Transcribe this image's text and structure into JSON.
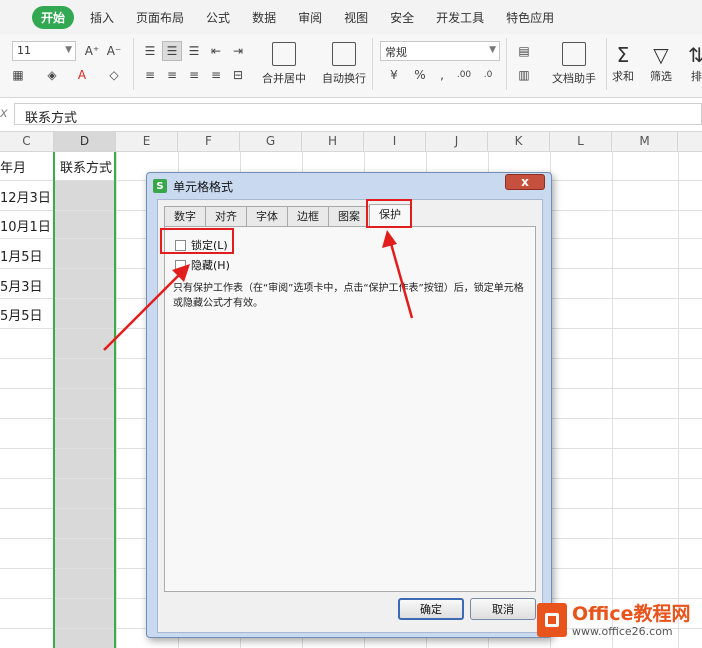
{
  "menubar": {
    "tabs": [
      {
        "label": "开始",
        "active": true
      },
      {
        "label": "插入"
      },
      {
        "label": "页面布局"
      },
      {
        "label": "公式"
      },
      {
        "label": "数据"
      },
      {
        "label": "审阅"
      },
      {
        "label": "视图"
      },
      {
        "label": "安全"
      },
      {
        "label": "开发工具"
      },
      {
        "label": "特色应用"
      }
    ]
  },
  "ribbon": {
    "font_size": "11",
    "number_format": "常规",
    "merge_label": "合并居中",
    "wrap_label": "自动换行",
    "doc_helper_label": "文档助手",
    "sum_label": "求和",
    "filter_label": "筛选",
    "sort_label": "排"
  },
  "formula_bar": {
    "fx_label": "x",
    "content": "联系方式"
  },
  "columns": [
    "C",
    "D",
    "E",
    "F",
    "G",
    "H",
    "I",
    "J",
    "K",
    "L",
    "M"
  ],
  "cells": {
    "c1": "年月",
    "d1": "联系方式",
    "c2": "12月3日",
    "c3": "10月1日",
    "c4": "1月5日",
    "c5": "5月3日",
    "c6": "5月5日"
  },
  "dialog": {
    "title": "单元格格式",
    "logo": "S",
    "close": "x",
    "tabs": [
      {
        "label": "数字"
      },
      {
        "label": "对齐"
      },
      {
        "label": "字体"
      },
      {
        "label": "边框"
      },
      {
        "label": "图案"
      },
      {
        "label": "保护",
        "active": true
      }
    ],
    "lock_label": "锁定(L)",
    "hide_label": "隐藏(H)",
    "description": "只有保护工作表（在“审阅”选项卡中，点击“保护工作表”按钮）后，锁定单元格或隐藏公式才有效。",
    "ok_label": "确定",
    "cancel_label": "取消"
  },
  "watermark": {
    "title": "Office教程网",
    "url": "www.office26.com"
  },
  "colors": {
    "accent_green": "#33a852",
    "annotation_red": "#e11d1d",
    "selection_border": "#3cab4a"
  }
}
